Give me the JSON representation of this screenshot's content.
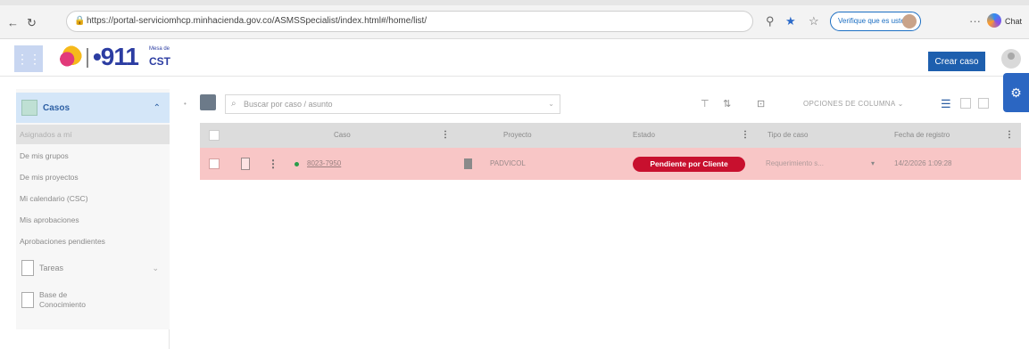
{
  "browser": {
    "url": "https://portal-serviciomhcp.minhacienda.gov.co/ASMSSpecialist/index.html#/home/list/",
    "verify_label": "Verifique que es usted",
    "chat_label": "Chat"
  },
  "header": {
    "logo_number": "•911",
    "logo_small": "Mesa de",
    "logo_cst": "CST",
    "create_case_label": "Crear caso"
  },
  "sidebar": {
    "casos_label": "Casos",
    "items": [
      {
        "label": "Asignados a mí"
      },
      {
        "label": "De mis grupos"
      },
      {
        "label": "De mis proyectos"
      },
      {
        "label": "Mi calendario (CSC)"
      },
      {
        "label": "Mis aprobaciones"
      },
      {
        "label": "Aprobaciones pendientes"
      }
    ],
    "tareas_label": "Tareas",
    "knowledge_label_1": "Base de",
    "knowledge_label_2": "Conocimiento"
  },
  "toolbar": {
    "search_placeholder": "Buscar por caso / asunto",
    "column_options": "OPCIONES DE COLUMNA"
  },
  "table": {
    "headers": {
      "caso": "Caso",
      "proyecto": "Proyecto",
      "estado": "Estado",
      "tipo": "Tipo de caso",
      "fecha": "Fecha de registro"
    },
    "rows": [
      {
        "caso": "8023-7950",
        "proyecto": "PADVICOL",
        "estado": "Pendiente por Cliente",
        "tipo": "Requerimiento s...",
        "fecha": "14/2/2026 1:09:28"
      }
    ]
  },
  "colors": {
    "accent": "#2b66c2",
    "status_pending": "#c8102e",
    "row_highlight": "#f8c6c6"
  }
}
